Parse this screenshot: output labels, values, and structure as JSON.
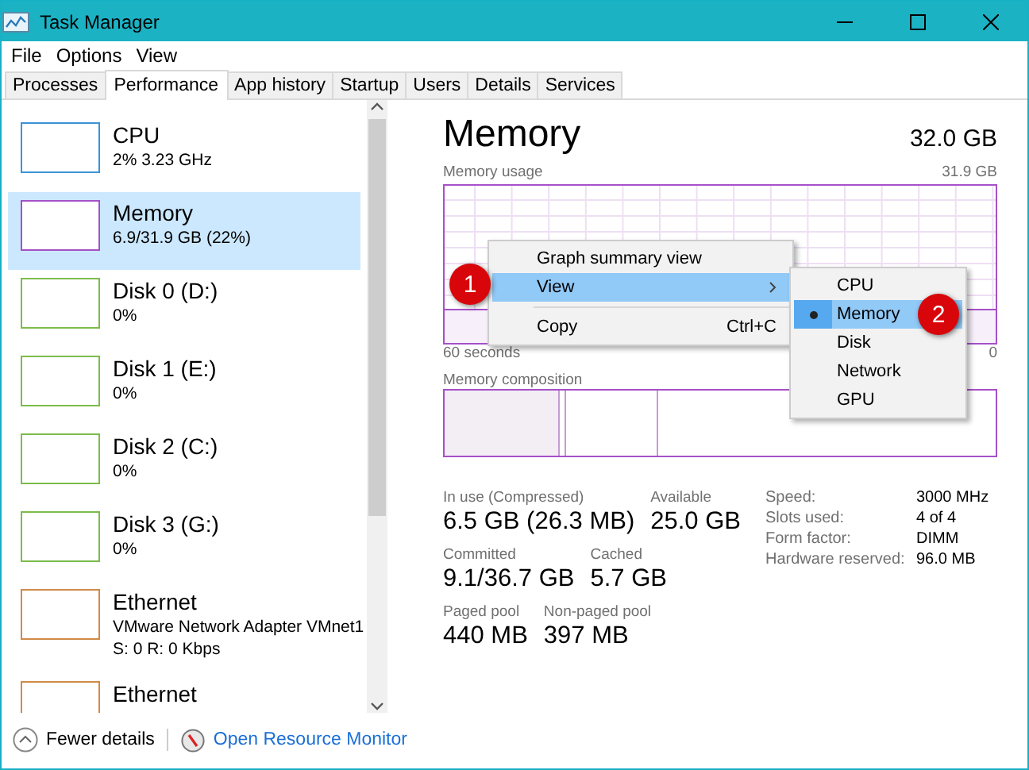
{
  "window": {
    "title": "Task Manager"
  },
  "menu": [
    "File",
    "Options",
    "View"
  ],
  "tabs": [
    {
      "label": "Processes",
      "selected": false
    },
    {
      "label": "Performance",
      "selected": true
    },
    {
      "label": "App history",
      "selected": false
    },
    {
      "label": "Startup",
      "selected": false
    },
    {
      "label": "Users",
      "selected": false
    },
    {
      "label": "Details",
      "selected": false
    },
    {
      "label": "Services",
      "selected": false
    }
  ],
  "sidebar": {
    "items": [
      {
        "name": "CPU",
        "detail": "2% 3.23 GHz",
        "color": "#3c93d6",
        "selected": false
      },
      {
        "name": "Memory",
        "detail": "6.9/31.9 GB (22%)",
        "color": "#a650c8",
        "selected": true
      },
      {
        "name": "Disk 0 (D:)",
        "detail": "0%",
        "color": "#7cbc4a",
        "selected": false
      },
      {
        "name": "Disk 1 (E:)",
        "detail": "0%",
        "color": "#7cbc4a",
        "selected": false
      },
      {
        "name": "Disk 2 (C:)",
        "detail": "0%",
        "color": "#7cbc4a",
        "selected": false
      },
      {
        "name": "Disk 3 (G:)",
        "detail": "0%",
        "color": "#7cbc4a",
        "selected": false
      },
      {
        "name": "Ethernet",
        "adapter": "VMware Network Adapter VMnet1",
        "detail": "S: 0 R: 0 Kbps",
        "color": "#d08a48",
        "selected": false
      },
      {
        "name": "Ethernet",
        "color": "#d08a48",
        "selected": false
      }
    ]
  },
  "panel": {
    "title": "Memory",
    "total": "32.0 GB",
    "usage_label": "Memory usage",
    "usage_max": "31.9 GB",
    "time_start": "60 seconds",
    "time_end": "0",
    "composition_label": "Memory composition",
    "stats": [
      [
        {
          "label": "In use (Compressed)",
          "value": "6.5 GB (26.3 MB)"
        },
        {
          "label": "Available",
          "value": "25.0 GB"
        }
      ],
      [
        {
          "label": "Committed",
          "value": "9.1/36.7 GB"
        },
        {
          "label": "Cached",
          "value": "5.7 GB"
        }
      ],
      [
        {
          "label": "Paged pool",
          "value": "440 MB"
        },
        {
          "label": "Non-paged pool",
          "value": "397 MB"
        }
      ]
    ],
    "specs": [
      {
        "label": "Speed:",
        "value": "3000 MHz"
      },
      {
        "label": "Slots used:",
        "value": "4 of 4"
      },
      {
        "label": "Form factor:",
        "value": "DIMM"
      },
      {
        "label": "Hardware reserved:",
        "value": "96.0 MB"
      }
    ]
  },
  "context_menu": {
    "items": [
      {
        "kind": "item",
        "label": "Graph summary view",
        "highlighted": false
      },
      {
        "kind": "submenu",
        "label": "View",
        "highlighted": true
      },
      {
        "kind": "separator"
      },
      {
        "kind": "item",
        "label": "Copy",
        "shortcut": "Ctrl+C",
        "highlighted": false
      }
    ],
    "submenu": [
      {
        "label": "CPU",
        "selected": false,
        "highlighted": false
      },
      {
        "label": "Memory",
        "selected": true,
        "highlighted": true
      },
      {
        "label": "Disk",
        "selected": false,
        "highlighted": false
      },
      {
        "label": "Network",
        "selected": false,
        "highlighted": false
      },
      {
        "label": "GPU",
        "selected": false,
        "highlighted": false
      }
    ]
  },
  "callouts": [
    "1",
    "2"
  ],
  "footer": {
    "fewer_details": "Fewer details",
    "link": "Open Resource Monitor"
  }
}
